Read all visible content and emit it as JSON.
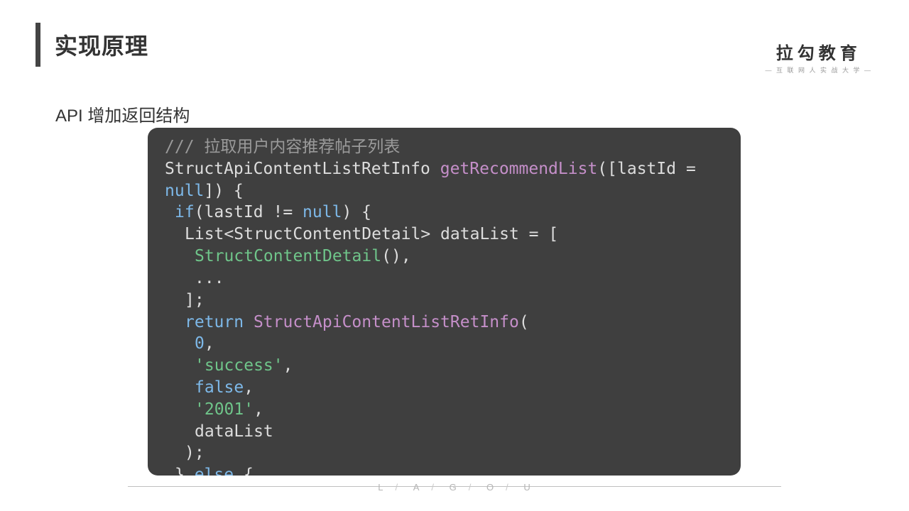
{
  "title": "实现原理",
  "logo": {
    "main": "拉勾教育",
    "sub": "— 互 联 网 人 实 战 大 学 —"
  },
  "subtitle": "API 增加返回结构",
  "code": {
    "comment": "/// 拉取用户内容推荐帖子列表",
    "ret_type": "StructApiContentListRetInfo",
    "func_name": "getRecommendList",
    "param_open": "([",
    "param_name": "lastId",
    "param_eq": " = ",
    "param_default": "null",
    "param_close": "]) {",
    "if_kw": "if",
    "if_open": "(",
    "if_var": "lastId",
    "if_op": " != ",
    "if_null": "null",
    "if_close": ") {",
    "list_decl_a": "List<",
    "list_decl_type": "StructContentDetail",
    "list_decl_b": "> dataList = [",
    "ctor1": "StructContentDetail",
    "ctor1_paren": "()",
    "comma": ",",
    "ellipsis": "...",
    "list_close": "];",
    "return_kw": "return",
    "ret_ctor": "StructApiContentListRetInfo",
    "ret_open": "(",
    "arg_num": "0",
    "arg_str1": "'success'",
    "arg_bool": "false",
    "arg_str2": "'2001'",
    "arg_ident": "dataList",
    "ret_close": ");",
    "block_close": "}",
    "else_kw": "else",
    "else_open": " {"
  },
  "footer": {
    "l": "L",
    "a": "A",
    "g": "G",
    "o": "O",
    "u": "U",
    "sep": "/"
  }
}
